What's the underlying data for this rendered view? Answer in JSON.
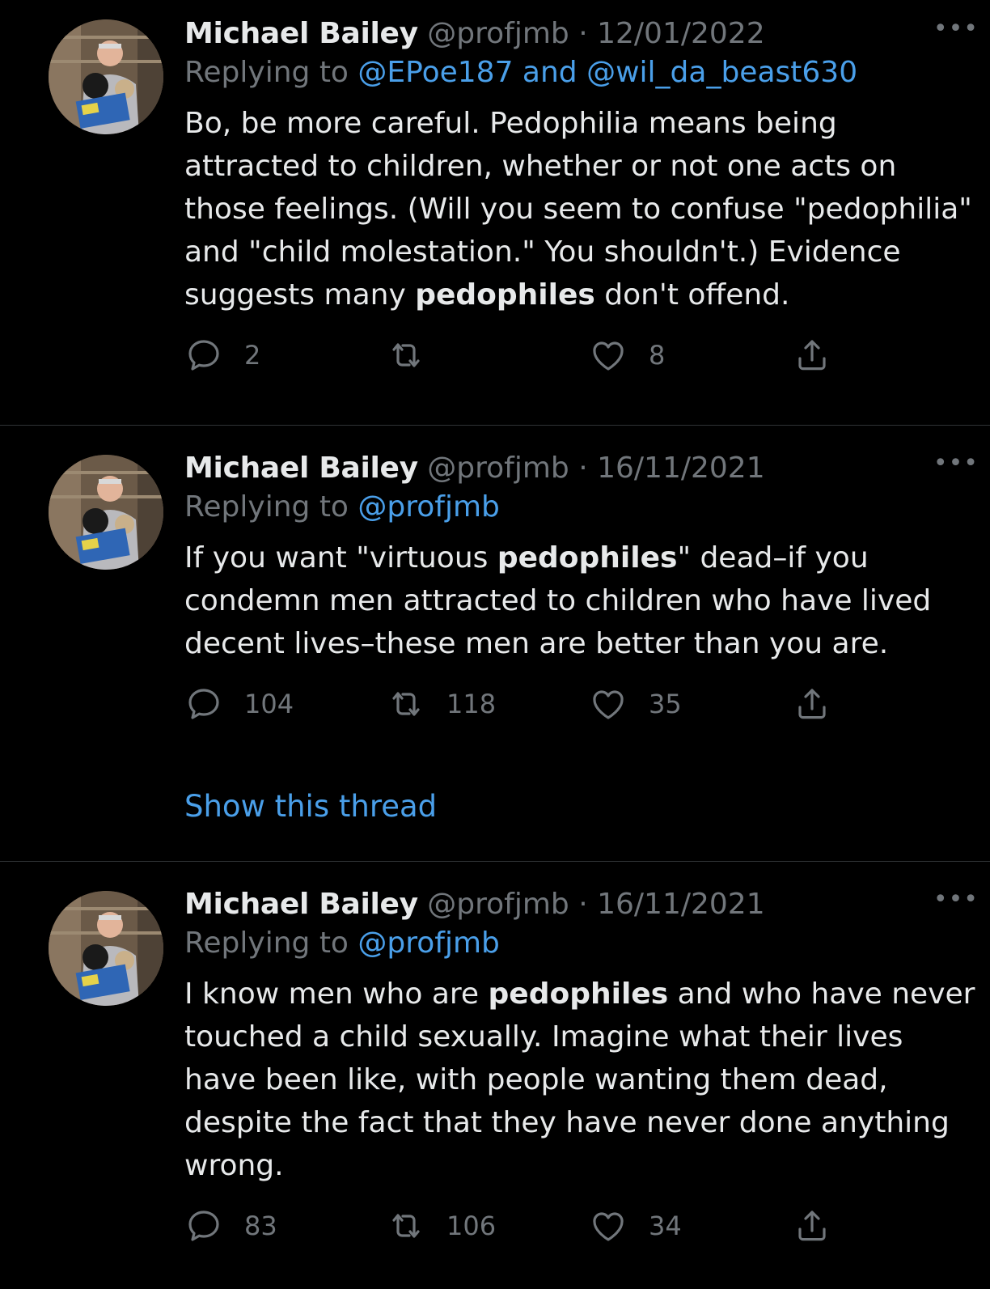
{
  "colors": {
    "background": "#000000",
    "text": "#e7e9ea",
    "secondary": "#71767b",
    "link": "#4a9fe9",
    "divider": "#2f3336"
  },
  "icons": {
    "reply": "reply-icon",
    "retweet": "retweet-icon",
    "like": "like-icon",
    "share": "share-icon",
    "more": "more-icon"
  },
  "tweets": [
    {
      "name": "Michael Bailey",
      "handle": "@profjmb",
      "separator": "·",
      "date": "12/01/2022",
      "more": "•••",
      "replying_prefix": "Replying to",
      "replying_to": "@EPoe187 and @wil_da_beast630",
      "text_parts": [
        "Bo, be more careful. Pedophilia means being attracted to children, whether or not one acts on those feelings. (Will you seem to confuse \"pedophilia\" and \"child molestation.\" You shouldn't.) Evidence suggests many ",
        "pedophiles",
        " don't offend."
      ],
      "reply_count": "2",
      "retweet_count": "",
      "like_count": "8"
    },
    {
      "name": "Michael Bailey",
      "handle": "@profjmb",
      "separator": "·",
      "date": "16/11/2021",
      "more": "•••",
      "replying_prefix": "Replying to",
      "replying_to": "@profjmb",
      "text_parts": [
        "If you want \"virtuous ",
        "pedophiles",
        "\" dead–if you condemn men attracted to children who have lived decent lives–these men are better than you are."
      ],
      "reply_count": "104",
      "retweet_count": "118",
      "like_count": "35",
      "show_thread": "Show this thread"
    },
    {
      "name": "Michael Bailey",
      "handle": "@profjmb",
      "separator": "·",
      "date": "16/11/2021",
      "more": "•••",
      "replying_prefix": "Replying to",
      "replying_to": "@profjmb",
      "text_parts": [
        "I know men who are ",
        "pedophiles",
        " and who have never touched a child sexually. Imagine what their lives have been like, with people wanting them dead, despite the fact that they have never done anything wrong."
      ],
      "reply_count": "83",
      "retweet_count": "106",
      "like_count": "34"
    }
  ]
}
